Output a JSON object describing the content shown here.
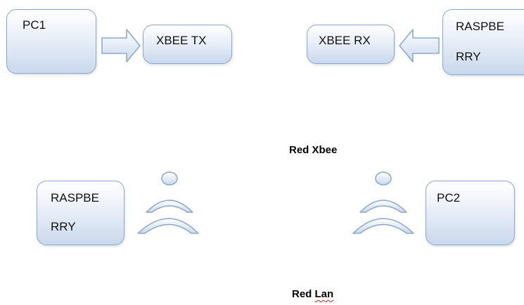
{
  "diagrams": {
    "xbee": {
      "pc_label": "PC1",
      "tx_label": "XBEE TX",
      "rx_label": "XBEE RX",
      "raspberry_label_line1": "RASPBE",
      "raspberry_label_line2": "RRY",
      "caption_prefix": "Red ",
      "caption_word": "Xbee"
    },
    "lan": {
      "raspberry_label_line1": "RASPBE",
      "raspberry_label_line2": "RRY",
      "pc_label": "PC2",
      "caption_prefix": "Red ",
      "caption_word": "Lan"
    }
  },
  "colors": {
    "box_border": "#8ca7cb",
    "box_fill_top": "#ffffff",
    "box_fill_bottom": "#c9d8ec",
    "spell_underline": "#cc2222"
  },
  "icons": [
    "right-arrow-icon",
    "left-arrow-icon",
    "wireless-signal-icon"
  ]
}
